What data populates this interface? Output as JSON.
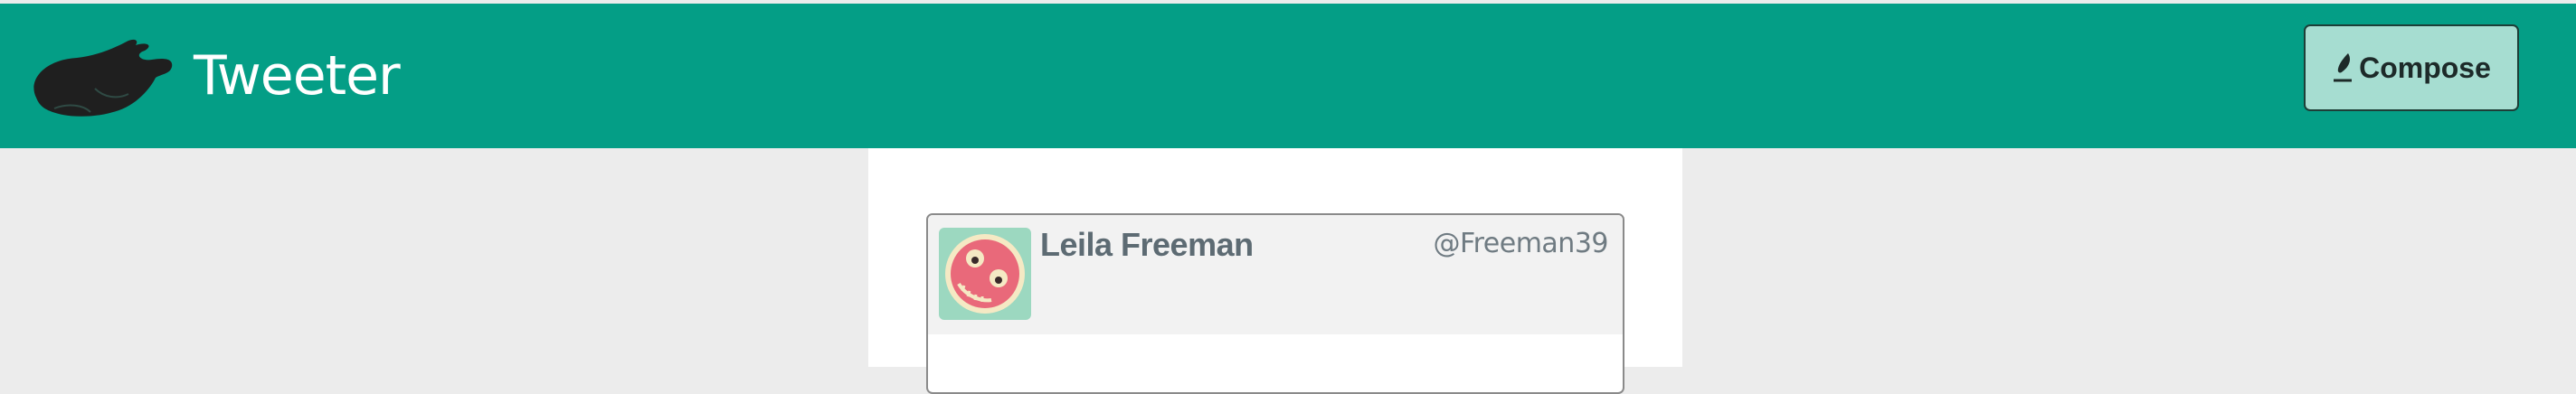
{
  "header": {
    "brand_title": "Tweeter",
    "logo_icon": "roast-chicken-icon",
    "compose_label": "Compose",
    "compose_icon": "quill-pen-icon"
  },
  "tweet": {
    "author_name": "Leila Freeman",
    "author_handle": "@Freeman39",
    "avatar_icon": "smiley-face-avatar"
  },
  "colors": {
    "header_bg": "#049e86",
    "page_bg": "#ececec",
    "compose_bg": "#a6ddd1",
    "card_header_bg": "#f2f2f2"
  }
}
